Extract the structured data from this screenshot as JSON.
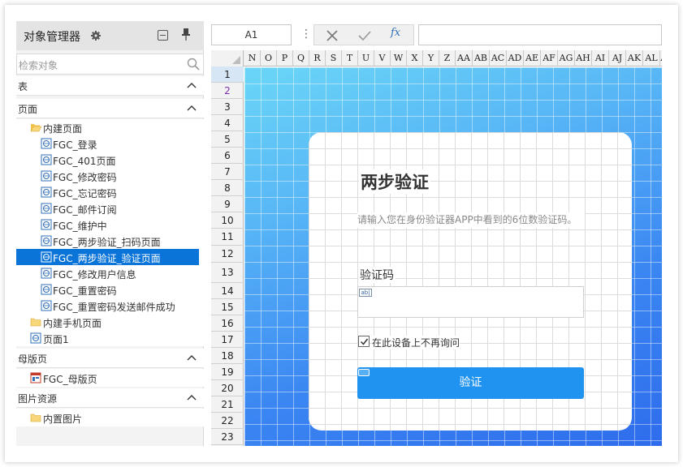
{
  "panel": {
    "title": "对象管理器",
    "search_placeholder": "检索对象",
    "sections": {
      "table": "表",
      "page": "页面",
      "master": "母版页",
      "images": "图片资源"
    },
    "tree": {
      "builtin_pages": "内建页面",
      "pages": [
        "FGC_登录",
        "FGC_401页面",
        "FGC_修改密码",
        "FGC_忘记密码",
        "FGC_邮件订阅",
        "FGC_维护中",
        "FGC_两步验证_扫码页面",
        "FGC_两步验证_验证页面",
        "FGC_修改用户信息",
        "FGC_重置密码",
        "FGC_重置密码发送邮件成功"
      ],
      "selected_index": 7,
      "mobile_pages": "内建手机页面",
      "page1": "页面1",
      "master_page": "FGC_母版页",
      "builtin_images": "内置图片"
    }
  },
  "toolbar": {
    "cell_ref": "A1",
    "fx": "fx"
  },
  "grid": {
    "columns": [
      "N",
      "O",
      "P",
      "Q",
      "R",
      "S",
      "T",
      "U",
      "V",
      "W",
      "X",
      "Y",
      "Z",
      "AA",
      "AB",
      "AC",
      "AD",
      "AE",
      "AF",
      "AG",
      "AH",
      "AI",
      "AJ",
      "AK",
      "AL",
      "AM"
    ],
    "rows": [
      "1",
      "2",
      "3",
      "4",
      "5",
      "6",
      "7",
      "8",
      "9",
      "10",
      "11",
      "12",
      "13",
      "14",
      "15",
      "16",
      "17",
      "18",
      "19",
      "20",
      "21",
      "22",
      "23"
    ]
  },
  "form": {
    "title": "两步验证",
    "description": "请输入您在身份验证器APP中看到的6位数验证码。",
    "code_label": "验证码",
    "input_badge": "ab|",
    "remember_label": "在此设备上不再询问",
    "remember_checked": true,
    "submit_label": "验证"
  },
  "colors": {
    "accent": "#0a74d8",
    "button": "#1f93ef"
  }
}
